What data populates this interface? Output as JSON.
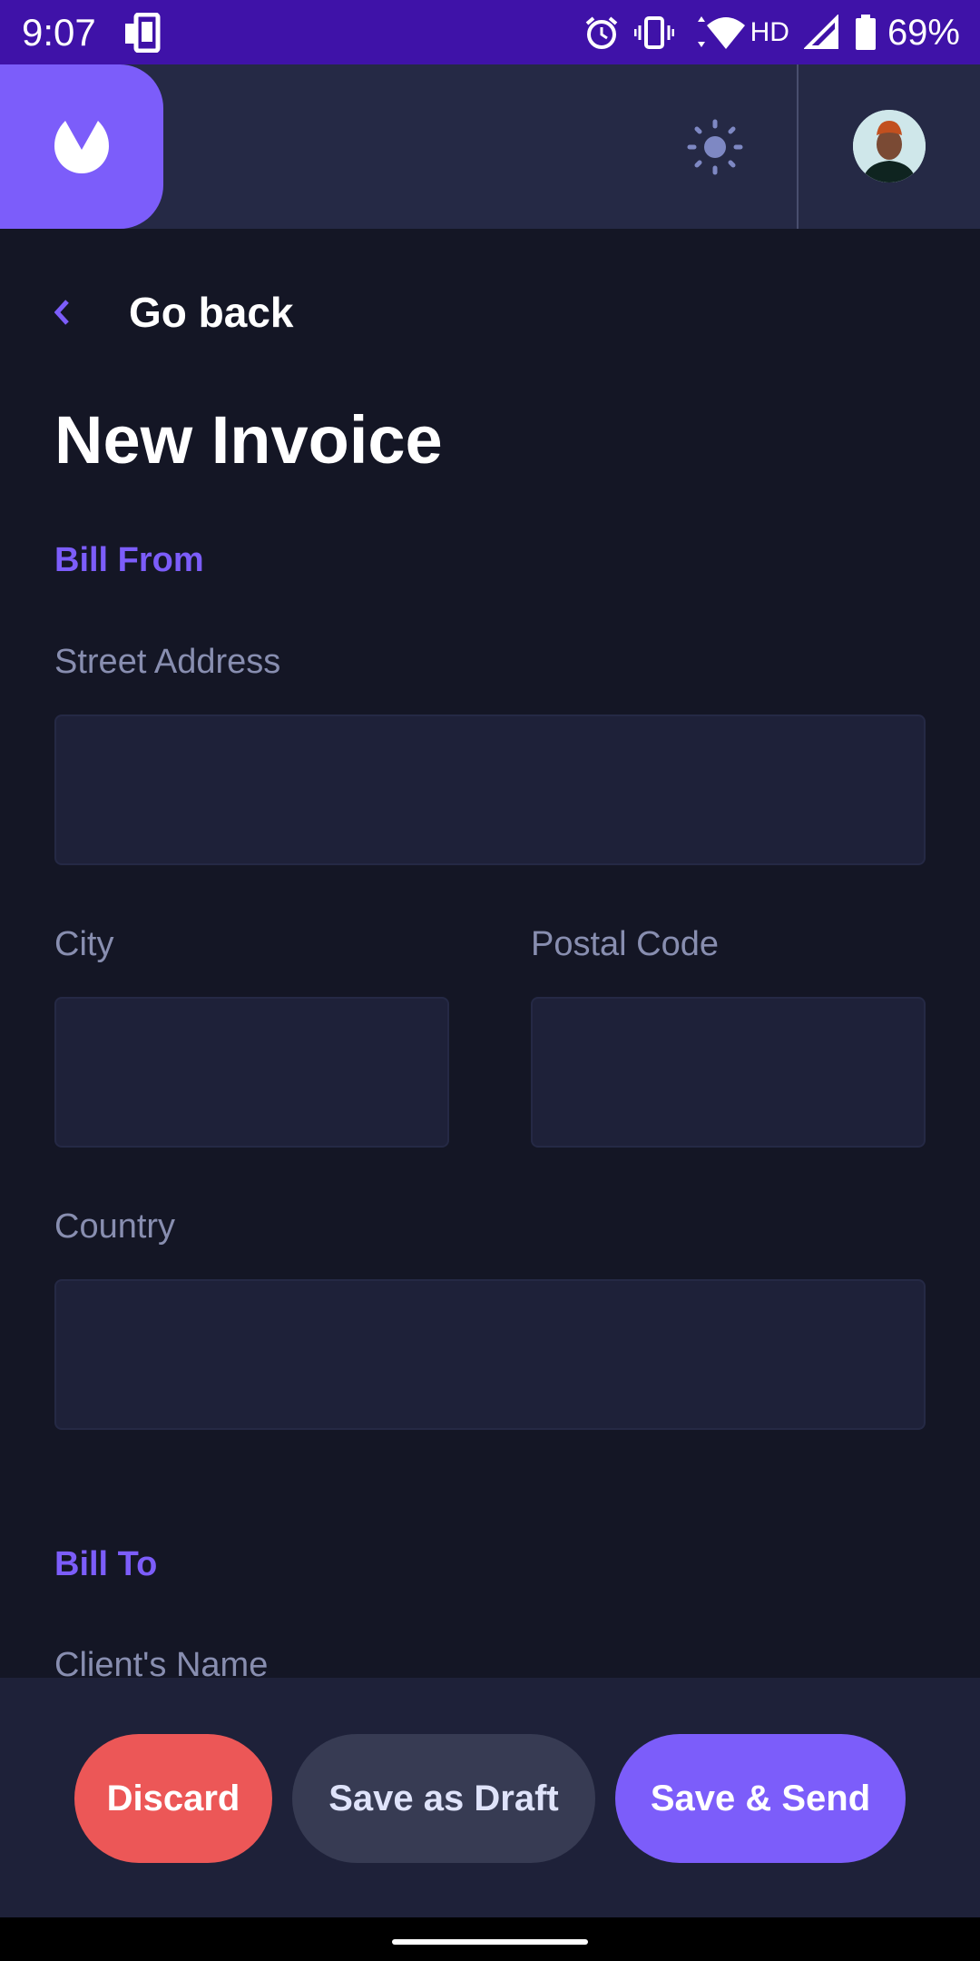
{
  "status_bar": {
    "time": "9:07",
    "battery_percent": "69%",
    "network_label": "HD",
    "icons": [
      "device-icon",
      "alarm-icon",
      "vibrate-icon",
      "wifi-icon",
      "signal-icon",
      "battery-icon"
    ]
  },
  "header": {
    "logo_icon": "app-logo-icon",
    "theme_icon": "sun-icon",
    "avatar_icon": "user-avatar"
  },
  "nav": {
    "back_label": "Go back"
  },
  "page": {
    "title": "New Invoice"
  },
  "bill_from": {
    "section_label": "Bill From",
    "street_label": "Street Address",
    "street_value": "",
    "city_label": "City",
    "city_value": "",
    "postal_label": "Postal Code",
    "postal_value": "",
    "country_label": "Country",
    "country_value": ""
  },
  "bill_to": {
    "section_label": "Bill To",
    "client_name_label": "Client's Name"
  },
  "actions": {
    "discard_label": "Discard",
    "draft_label": "Save as Draft",
    "send_label": "Save & Send"
  },
  "colors": {
    "accent": "#7c5dfa",
    "danger": "#ec5757",
    "background": "#141625",
    "surface": "#1e2139",
    "status_bar": "#3f12a8"
  }
}
